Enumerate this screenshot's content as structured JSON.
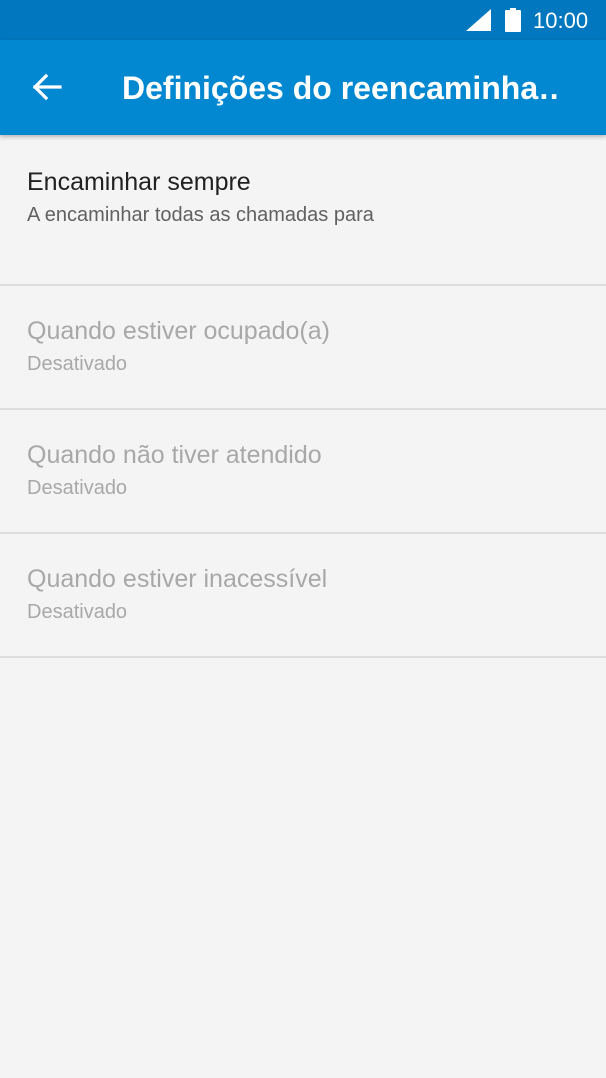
{
  "status_bar": {
    "time": "10:00",
    "icons": [
      "cellular-signal-icon",
      "battery-icon"
    ],
    "background_color": "#0077be"
  },
  "app_bar": {
    "title": "Definições do reencaminha…",
    "back_icon": "arrow-back-icon",
    "background_color": "#0288d1"
  },
  "forwarding_options": [
    {
      "label": "Encaminhar sempre",
      "summary": "A encaminhar todas as chamadas para",
      "enabled": true
    },
    {
      "label": "Quando estiver ocupado(a)",
      "summary": "Desativado",
      "enabled": false
    },
    {
      "label": "Quando não tiver atendido",
      "summary": "Desativado",
      "enabled": false
    },
    {
      "label": "Quando estiver inacessível",
      "summary": "Desativado",
      "enabled": false
    }
  ]
}
